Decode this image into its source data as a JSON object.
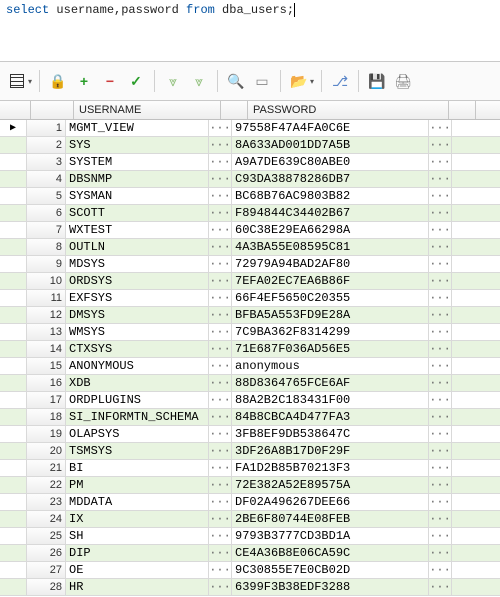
{
  "sql": {
    "keyword1": "select",
    "fields": " username,password ",
    "keyword2": "from",
    "table": " dba_users;"
  },
  "columns": {
    "username": "USERNAME",
    "password": "PASSWORD"
  },
  "ellipsis": "···",
  "rows": [
    {
      "n": 1,
      "u": "MGMT_VIEW",
      "p": "97558F47A4FA0C6E",
      "cur": true
    },
    {
      "n": 2,
      "u": "SYS",
      "p": "8A633AD001DD7A5B"
    },
    {
      "n": 3,
      "u": "SYSTEM",
      "p": "A9A7DE639C80ABE0"
    },
    {
      "n": 4,
      "u": "DBSNMP",
      "p": "C93DA38878286DB7"
    },
    {
      "n": 5,
      "u": "SYSMAN",
      "p": "BC68B76AC9803B82"
    },
    {
      "n": 6,
      "u": "SCOTT",
      "p": "F894844C34402B67"
    },
    {
      "n": 7,
      "u": "WXTEST",
      "p": "60C38E29EA66298A"
    },
    {
      "n": 8,
      "u": "OUTLN",
      "p": "4A3BA55E08595C81"
    },
    {
      "n": 9,
      "u": "MDSYS",
      "p": "72979A94BAD2AF80"
    },
    {
      "n": 10,
      "u": "ORDSYS",
      "p": "7EFA02EC7EA6B86F"
    },
    {
      "n": 11,
      "u": "EXFSYS",
      "p": "66F4EF5650C20355"
    },
    {
      "n": 12,
      "u": "DMSYS",
      "p": "BFBA5A553FD9E28A"
    },
    {
      "n": 13,
      "u": "WMSYS",
      "p": "7C9BA362F8314299"
    },
    {
      "n": 14,
      "u": "CTXSYS",
      "p": "71E687F036AD56E5"
    },
    {
      "n": 15,
      "u": "ANONYMOUS",
      "p": "anonymous"
    },
    {
      "n": 16,
      "u": "XDB",
      "p": "88D8364765FCE6AF"
    },
    {
      "n": 17,
      "u": "ORDPLUGINS",
      "p": "88A2B2C183431F00"
    },
    {
      "n": 18,
      "u": "SI_INFORMTN_SCHEMA",
      "p": "84B8CBCA4D477FA3"
    },
    {
      "n": 19,
      "u": "OLAPSYS",
      "p": "3FB8EF9DB538647C"
    },
    {
      "n": 20,
      "u": "TSMSYS",
      "p": "3DF26A8B17D0F29F"
    },
    {
      "n": 21,
      "u": "BI",
      "p": "FA1D2B85B70213F3"
    },
    {
      "n": 22,
      "u": "PM",
      "p": "72E382A52E89575A"
    },
    {
      "n": 23,
      "u": "MDDATA",
      "p": "DF02A496267DEE66"
    },
    {
      "n": 24,
      "u": "IX",
      "p": "2BE6F80744E08FEB"
    },
    {
      "n": 25,
      "u": "SH",
      "p": "9793B3777CD3BD1A"
    },
    {
      "n": 26,
      "u": "DIP",
      "p": "CE4A36B8E06CA59C"
    },
    {
      "n": 27,
      "u": "OE",
      "p": "9C30855E7E0CB02D"
    },
    {
      "n": 28,
      "u": "HR",
      "p": "6399F3B38EDF3288"
    }
  ]
}
